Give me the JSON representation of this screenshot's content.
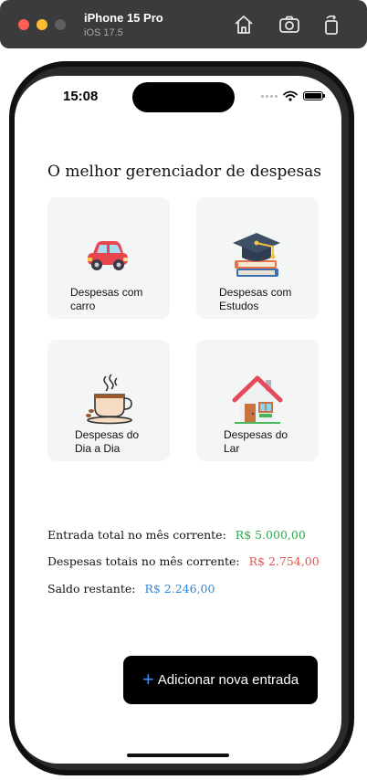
{
  "simulator": {
    "device_name": "iPhone 15 Pro",
    "os_version": "iOS 17.5"
  },
  "status_bar": {
    "time": "15:08"
  },
  "app": {
    "headline": "O melhor gerenciador de despesas",
    "categories": [
      {
        "label": "Despesas com\ncarro",
        "icon": "car-icon"
      },
      {
        "label": "Despesas com\nEstudos",
        "icon": "graduation-icon"
      },
      {
        "label": "Despesas do\nDia a Dia",
        "icon": "coffee-icon"
      },
      {
        "label": "Despesas do\nLar",
        "icon": "house-icon"
      }
    ],
    "summary": {
      "income_label": "Entrada total no mês corrente:",
      "income_value": "R$ 5.000,00",
      "expenses_label": "Despesas totais no mês corrente:",
      "expenses_value": "R$ 2.754,00",
      "balance_label": "Saldo restante:",
      "balance_value": "R$ 2.246,00"
    },
    "add_button": {
      "plus": "+",
      "label": "Adicionar nova entrada"
    }
  },
  "colors": {
    "income": "#2aa84a",
    "expenses": "#e5534b",
    "balance": "#2a8ae0",
    "accent": "#3a8bff"
  }
}
